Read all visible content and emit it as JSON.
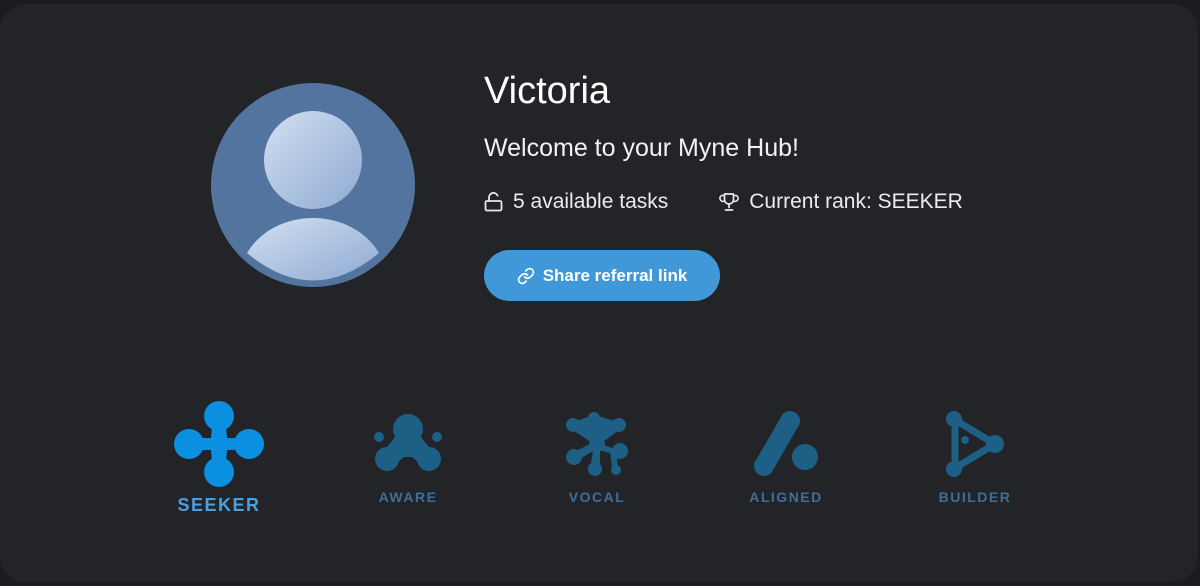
{
  "profile": {
    "name": "Victoria",
    "welcome": "Welcome to your Myne Hub!",
    "tasks": "5 available tasks",
    "rank": "Current rank: SEEKER",
    "share_label": "Share referral link"
  },
  "ranks": [
    {
      "label": "SEEKER",
      "icon": "seeker-icon",
      "active": true
    },
    {
      "label": "AWARE",
      "icon": "aware-icon",
      "active": false
    },
    {
      "label": "VOCAL",
      "icon": "vocal-icon",
      "active": false
    },
    {
      "label": "ALIGNED",
      "icon": "aligned-icon",
      "active": false
    },
    {
      "label": "BUILDER",
      "icon": "builder-icon",
      "active": false
    }
  ],
  "colors": {
    "background": "#232428",
    "accent": "#4198d9",
    "active_rank": "#0b8fe0",
    "inactive_rank": "#1e5f86",
    "avatar": "#5474a0"
  }
}
